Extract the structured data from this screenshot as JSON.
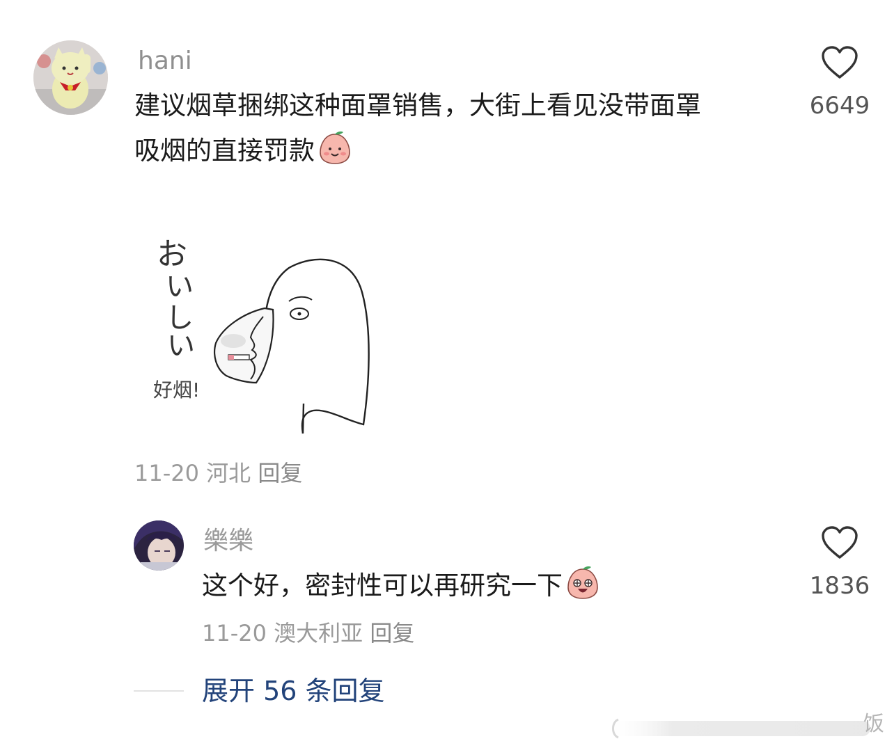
{
  "comment": {
    "username": "hani",
    "text_line1": "建议烟草捆绑这种面罩销售，大街上看见没带面罩",
    "text_line2": "吸烟的直接罚款",
    "emoji_icon": "peach-smile-emoji",
    "sticker": {
      "caption_jp": "おいしい",
      "caption_cn": "好烟!"
    },
    "date": "11-20",
    "location": "河北",
    "reply_label": "回复",
    "likes": "6649",
    "like_icon": "heart-outline-icon"
  },
  "reply": {
    "username": "樂樂",
    "text": "这个好，密封性可以再研究一下",
    "emoji_icon": "peach-starry-eyes-emoji",
    "date": "11-20",
    "location": "澳大利亚",
    "reply_label": "回复",
    "likes": "1836",
    "like_icon": "heart-outline-icon"
  },
  "expand": {
    "label": "展开 56 条回复"
  },
  "watermark": {
    "text": "饭"
  },
  "colors": {
    "text": "#1a1a1a",
    "muted": "#9a9a9a",
    "link": "#22437a"
  }
}
